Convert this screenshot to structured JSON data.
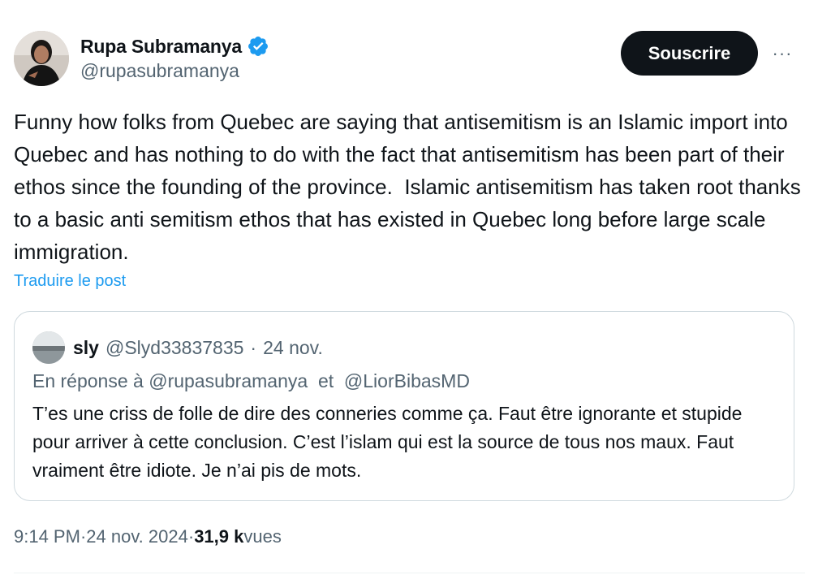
{
  "author": {
    "display_name": "Rupa Subramanya",
    "handle": "@rupasubramanya",
    "verified": true,
    "verified_color": "#1d9bf0"
  },
  "actions": {
    "subscribe_label": "Souscrire",
    "more_label": "···"
  },
  "post": {
    "text": "Funny how folks from Quebec are saying that antisemitism is an Islamic import into Quebec and has nothing to do with the fact that antisemitism has been part of their ethos since the founding of the province.  Islamic antisemitism has taken root thanks to a basic anti semitism ethos that has existed in Quebec long before large scale immigration.",
    "translate_label": "Traduire le post"
  },
  "quote": {
    "display_name": "sly",
    "handle": "@Slyd33837835",
    "separator": "·",
    "date": "24 nov.",
    "reply_prefix": "En réponse à",
    "reply_to_1": "@rupasubramanya",
    "reply_joiner": "et",
    "reply_to_2": "@LiorBibasMD",
    "text": "T’es une criss de folle de dire des conneries comme ça. Faut être ignorante et stupide pour arriver à cette conclusion. C’est l’islam qui est la source de tous nos maux. Faut vraiment être idiote. Je n’ai pis de mots."
  },
  "meta": {
    "time": "9:14 PM",
    "separator": "·",
    "date": "24 nov. 2024",
    "views_count": "31,9 k",
    "views_label": "vues"
  },
  "colors": {
    "text_primary": "#0f1419",
    "text_secondary": "#536471",
    "link": "#1d9bf0",
    "border": "#cfd9de",
    "button_bg": "#0f1419"
  }
}
